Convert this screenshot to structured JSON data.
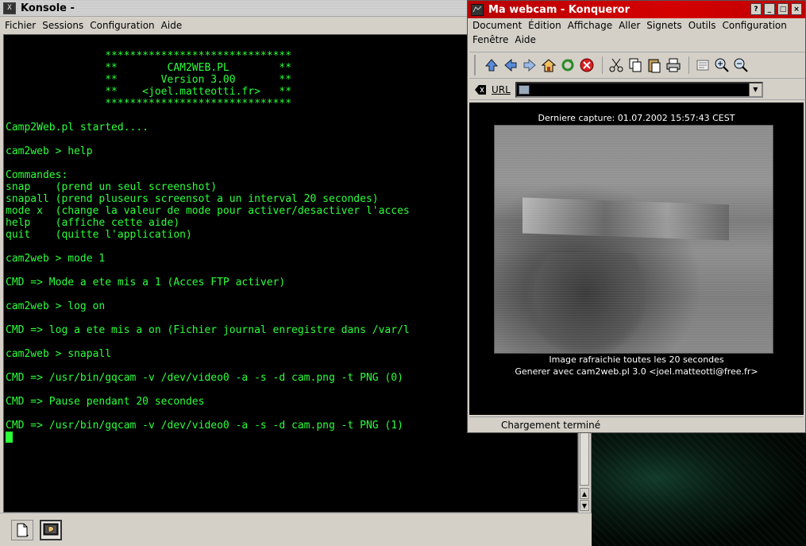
{
  "konsole": {
    "window_title": "Konsole -",
    "window_icon": "X",
    "menu": [
      "Fichier",
      "Sessions",
      "Configuration",
      "Aide"
    ],
    "terminal_lines": [
      "                ******************************",
      "                **        CAM2WEB.PL        **",
      "                **       Version 3.00       **",
      "                **    <joel.matteotti.fr>   **",
      "                ******************************",
      "",
      "Camp2Web.pl started....",
      "",
      "cam2web > help",
      "",
      "Commandes:",
      "snap    (prend un seul screenshot)",
      "snapall (prend pluseurs screensot a un interval 20 secondes)",
      "mode x  (change la valeur de mode pour activer/desactiver l'acces",
      "help    (affiche cette aide)",
      "quit    (quitte l'application)",
      "",
      "cam2web > mode 1",
      "",
      "CMD => Mode a ete mis a 1 (Acces FTP activer)",
      "",
      "cam2web > log on",
      "",
      "CMD => log a ete mis a on (Fichier journal enregistre dans /var/l",
      "",
      "cam2web > snapall",
      "",
      "CMD => /usr/bin/gqcam -v /dev/video0 -a -s -d cam.png -t PNG (0)",
      "",
      "CMD => Pause pendant 20 secondes",
      "",
      "CMD => /usr/bin/gqcam -v /dev/video0 -a -s -d cam.png -t PNG (1)"
    ],
    "icons": {
      "new_session": "new-document-icon",
      "terminal_session": "terminal-shell-icon"
    },
    "colors": {
      "terminal_text": "#2cff3a",
      "terminal_bg": "#000000"
    }
  },
  "konqueror": {
    "window_title": "Ma webcam - Konqueror",
    "menu_row1": [
      "Document",
      "Édition",
      "Affichage",
      "Aller",
      "Signets",
      "Outils",
      "Configuration"
    ],
    "menu_row2": [
      "Fenêtre",
      "Aide"
    ],
    "title_buttons": [
      "?",
      "_",
      "□",
      "×"
    ],
    "url_label": "URL",
    "url_value": "",
    "page": {
      "capture_text": "Derniere capture: 01.07.2002 15:57:43 CEST",
      "refresh_text": "Image rafraichie toutes les 20 secondes",
      "generated_text": "Generer avec cam2web.pl 3.0 <joel.matteotti@free.fr>"
    },
    "status_text": "Chargement terminé",
    "colors": {
      "titlebar": "#c80000",
      "page_bg": "#000000"
    }
  }
}
